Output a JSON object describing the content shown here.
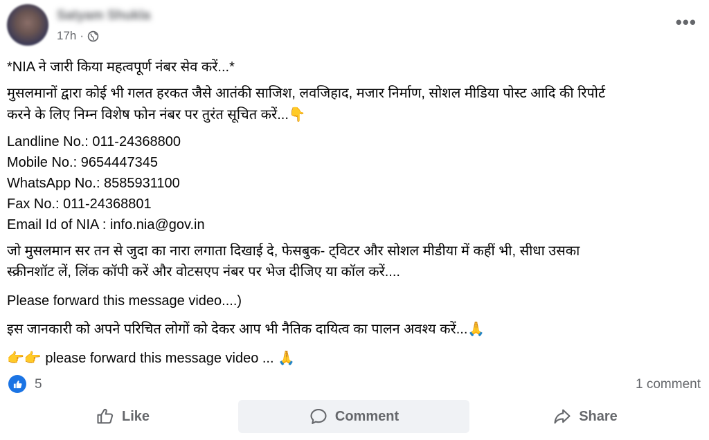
{
  "post": {
    "author": "Satyam Shukla",
    "time": "17h",
    "visibility_icon": "globe-icon",
    "more_icon": "more-options-icon",
    "title": "*NIA ने जारी किया महत्वपूर्ण नंबर सेव करें...*",
    "intro": "मुसलमानों द्वारा कोई भी गलत हरकत जैसे आतंकी साजिश, लवजिहाद, मजार निर्माण, सोशल मीडिया पोस्ट आदि की रिपोर्ट\nकरने के लिए निम्न विशेष फोन नंबर पर तुरंत सूचित करें...",
    "intro_emoji": "👇",
    "contacts": [
      "Landline No.: 011-24368800",
      "Mobile No.: 9654447345",
      "WhatsApp No.: 8585931100",
      "Fax No.: 011-24368801",
      "Email Id of NIA : info.nia@gov.in"
    ],
    "appeal": "जो मुसलमान सर तन से जुदा का नारा लगाता दिखाई दे, फेसबुक- ट्विटर और सोशल मीडीया में कहीं भी, सीधा उसका\nस्क्रीनशॉट लें, लिंक कॉपी करें और वोटसएप नंबर पर भेज दीजिए या कॉल करें....",
    "forward_note": "Please forward this message video....)",
    "duty": "इस जानकारी को अपने परिचित लोगों को देकर आप भी नैतिक दायित्व का पालन अवश्य करें...",
    "duty_emoji": "🙏",
    "forward_prefix_emoji": "👉👉",
    "forward_text": "please forward this message video ...",
    "forward_suffix_emoji": "🙏"
  },
  "stats": {
    "like_count": "5",
    "comment_count": "1 comment"
  },
  "actions": {
    "like_label": "Like",
    "comment_label": "Comment",
    "share_label": "Share"
  },
  "colors": {
    "like_blue": "#1b74e4",
    "secondary_text": "#65676b",
    "hover_bg": "#f0f2f5"
  }
}
